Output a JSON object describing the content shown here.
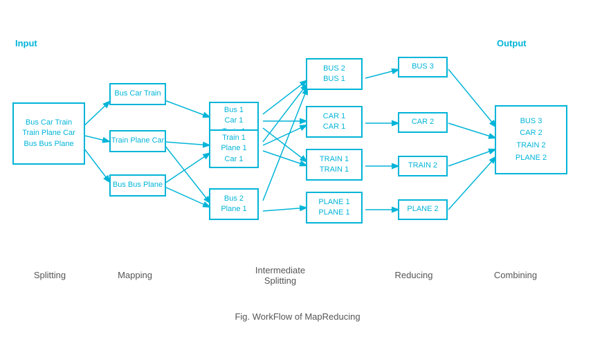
{
  "title": "WorkFlow of MapReducing",
  "labels": {
    "input": "Input",
    "output": "Output",
    "splitting": "Splitting",
    "mapping": "Mapping",
    "intermediate_splitting": "Intermediate\nSplitting",
    "reducing": "Reducing",
    "combining": "Combining",
    "fig": "Fig. WorkFlow of MapReducing"
  },
  "boxes": {
    "input": "Bus Car Train\nTrain Plane Car\nBus Bus Plane",
    "map1": "Bus Car Train",
    "map2": "Train Plane Car",
    "map3": "Bus Bus Plane",
    "split1": "Bus 1\nCar 1\nTrain 1",
    "split2": "Train 1\nPlane 1\nCar 1",
    "split3": "Bus 2\nPlane 1",
    "inter1": "BUS 2\nBUS 1",
    "inter2": "CAR 1\nCAR 1",
    "inter3": "TRAIN 1\nTRAIN 1",
    "inter4": "PLANE 1\nPLANE 1",
    "reduce1": "BUS 3",
    "reduce2": "CAR  2",
    "reduce3": "TRAIN 2",
    "reduce4": "PLANE 2",
    "output": "BUS 3\nCAR 2\nTRAIN 2\nPLANE 2"
  }
}
